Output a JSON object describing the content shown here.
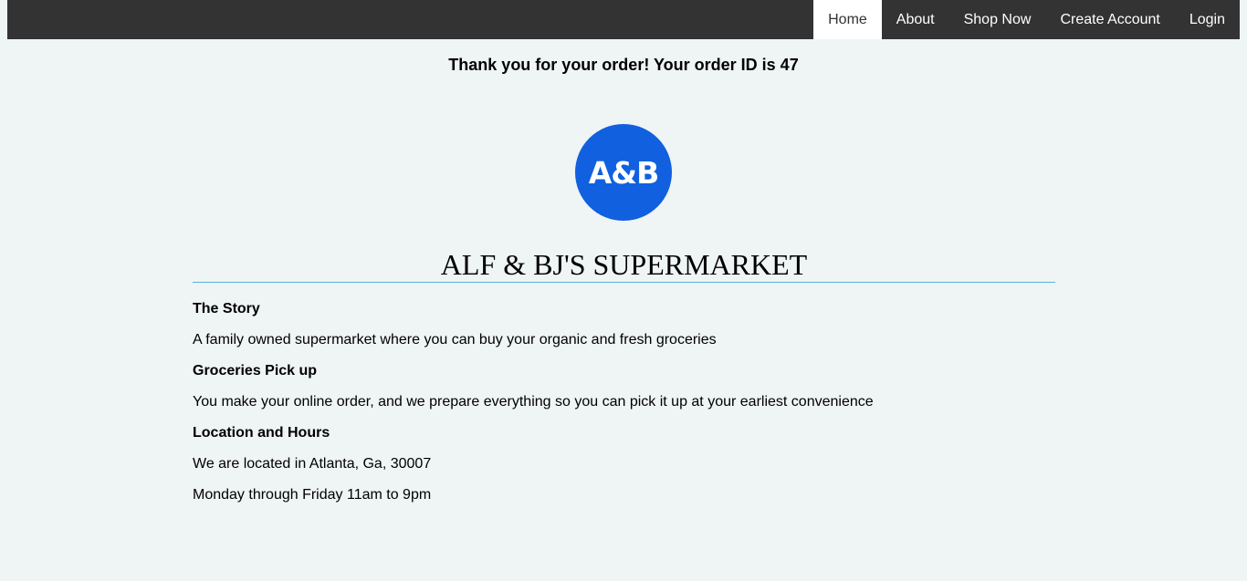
{
  "nav": {
    "items": [
      {
        "label": "Home"
      },
      {
        "label": "About"
      },
      {
        "label": "Shop Now"
      },
      {
        "label": "Create Account"
      },
      {
        "label": "Login"
      }
    ],
    "active": "Home"
  },
  "order": {
    "message": "Thank you for your order! Your order ID is 47"
  },
  "logo": {
    "text": "A&B",
    "color": "#1060e0"
  },
  "store": {
    "title": "ALF & BJ'S SUPERMARKET"
  },
  "about": {
    "story_heading": "The Story",
    "story_text": "A family owned supermarket where you can buy your organic and fresh groceries",
    "pickup_heading": "Groceries Pick up",
    "pickup_text": "You make your online order, and we prepare everything so you can pick it up at your earliest convenience",
    "location_heading": "Location and Hours",
    "location_text": "We are located in Atlanta, Ga, 30007",
    "hours_text": "Monday through Friday 11am to 9pm"
  },
  "colors": {
    "navbar": "#333333",
    "background": "#eff4f4",
    "rule": "#5ab0dc"
  }
}
